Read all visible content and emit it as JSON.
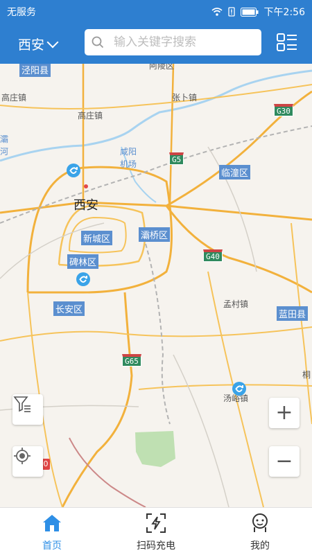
{
  "status": {
    "carrier": "无服务",
    "time": "下午2:56"
  },
  "header": {
    "city": "西安",
    "search_placeholder": "输入关键字搜索"
  },
  "map": {
    "city_name": "西安",
    "districts": [
      "泾阳县",
      "新城区",
      "碑林区",
      "长安区",
      "灞桥区",
      "临潼区",
      "蓝田县"
    ],
    "places": [
      "高庄镇",
      "高庄镇",
      "张卜镇",
      "孟村镇",
      "汤峪镇",
      "灞",
      "河",
      "咸阳",
      "机场",
      "阿陵区",
      "桐"
    ],
    "highways": [
      "G30",
      "G5",
      "G40",
      "G65"
    ],
    "badge": "0"
  },
  "controls": {
    "zoom_in": "+",
    "zoom_out": "−"
  },
  "tabs": [
    {
      "label": "首页",
      "active": true
    },
    {
      "label": "扫码充电",
      "active": false
    },
    {
      "label": "我的",
      "active": false
    }
  ],
  "colors": {
    "brand": "#2e7fd0",
    "road_major": "#f2b13c",
    "district_tag": "#5b8fcf",
    "park": "#bfe0b2"
  }
}
